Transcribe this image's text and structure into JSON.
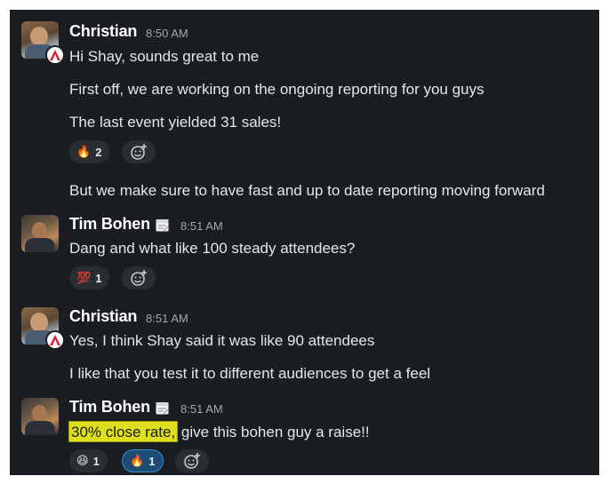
{
  "messages": [
    {
      "author": "Christian",
      "time": "8:50 AM",
      "lines": [
        "Hi Shay, sounds great to me",
        "First off, we are working on the ongoing reporting for you guys",
        "The last event yielded 31 sales!"
      ],
      "reactions": [
        {
          "emoji": "🔥",
          "count": "2"
        }
      ],
      "after_line": "But we make sure to have fast and up to date reporting moving forward"
    },
    {
      "author": "Tim Bohen",
      "time": "8:51 AM",
      "lines": [
        "Dang and what like 100 steady attendees?"
      ],
      "reactions": [
        {
          "emoji": "💯",
          "count": "1"
        }
      ]
    },
    {
      "author": "Christian",
      "time": "8:51 AM",
      "lines": [
        "Yes, I think Shay said it was like 90 attendees",
        "I like that you test it to different audiences to get a feel"
      ]
    },
    {
      "author": "Tim Bohen",
      "time": "8:51 AM",
      "highlight": "30% close rate,",
      "rest": " give this bohen guy a raise!!",
      "reactions": [
        {
          "emoji": "😆",
          "count": "1",
          "active": false
        },
        {
          "emoji": "🔥",
          "count": "1",
          "active": true
        }
      ]
    }
  ],
  "icons": {
    "add_reaction": "add-reaction-icon",
    "calendar_status": "calendar-icon",
    "app_badge": "app-logo-badge"
  },
  "colors": {
    "background": "#1a1d21",
    "highlight": "#dede1f",
    "active_reaction": "#1d4c76"
  }
}
